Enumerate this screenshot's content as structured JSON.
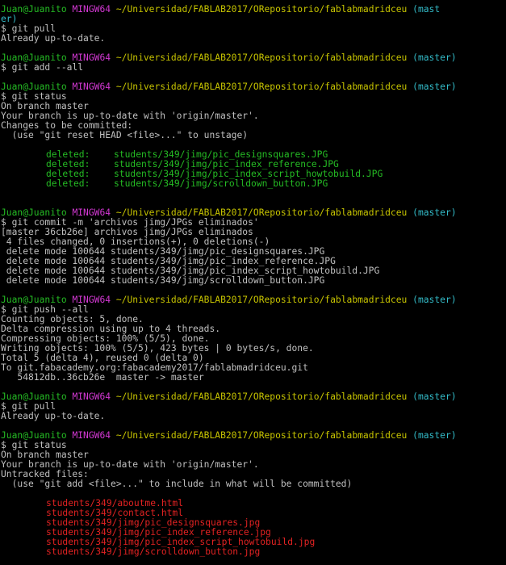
{
  "prompt": {
    "user": "Juan@Juanito",
    "env": "MINGW64",
    "path": "~/Universidad/FABLAB2017/ORepositorio/fablabmadridceu",
    "branch": "(master)",
    "branch_wrap_1": "(mast",
    "branch_wrap_2": "er)",
    "dollar": "$"
  },
  "blocks": [
    {
      "command": "git pull",
      "output": [
        "Already up-to-date."
      ]
    },
    {
      "command": "git add --all",
      "output": []
    },
    {
      "command": "git status",
      "output": [
        "On branch master",
        "Your branch is up-to-date with 'origin/master'.",
        "Changes to be committed:",
        "  (use \"git reset HEAD <file>...\" to unstage)"
      ],
      "staged": [
        {
          "status": "deleted:",
          "file": "students/349/jimg/pic_designsquares.JPG"
        },
        {
          "status": "deleted:",
          "file": "students/349/jimg/pic_index_reference.JPG"
        },
        {
          "status": "deleted:",
          "file": "students/349/jimg/pic_index_script_howtobuild.JPG"
        },
        {
          "status": "deleted:",
          "file": "students/349/jimg/scrolldown_button.JPG"
        }
      ]
    },
    {
      "command": "git commit -m 'archivos jimg/JPGs eliminados'",
      "output": [
        "[master 36cb26e] archivos jimg/JPGs eliminados",
        " 4 files changed, 0 insertions(+), 0 deletions(-)",
        " delete mode 100644 students/349/jimg/pic_designsquares.JPG",
        " delete mode 100644 students/349/jimg/pic_index_reference.JPG",
        " delete mode 100644 students/349/jimg/pic_index_script_howtobuild.JPG",
        " delete mode 100644 students/349/jimg/scrolldown_button.JPG"
      ]
    },
    {
      "command": "git push --all",
      "output": [
        "Counting objects: 5, done.",
        "Delta compression using up to 4 threads.",
        "Compressing objects: 100% (5/5), done.",
        "Writing objects: 100% (5/5), 423 bytes | 0 bytes/s, done.",
        "Total 5 (delta 4), reused 0 (delta 0)",
        "To git.fabacademy.org:fabacademy2017/fablabmadridceu.git",
        "   54812db..36cb26e  master -> master"
      ]
    },
    {
      "command": "git pull",
      "output": [
        "Already up-to-date."
      ]
    },
    {
      "command": "git status",
      "output": [
        "On branch master",
        "Your branch is up-to-date with 'origin/master'.",
        "Untracked files:",
        "  (use \"git add <file>...\" to include in what will be committed)"
      ],
      "untracked": [
        "students/349/aboutme.html",
        "students/349/contact.html",
        "students/349/jimg/pic_designsquares.jpg",
        "students/349/jimg/pic_index_reference.jpg",
        "students/349/jimg/pic_index_script_howtobuild.jpg",
        "students/349/jimg/scrolldown_button.jpg"
      ]
    }
  ],
  "colors": {
    "background": "#000000",
    "text": "#c0c0c0",
    "user": "#25bc24",
    "mingw": "#d338d3",
    "path": "#c7c400",
    "branch": "#33bbc8",
    "staged": "#25bc24",
    "untracked": "#e22222"
  }
}
